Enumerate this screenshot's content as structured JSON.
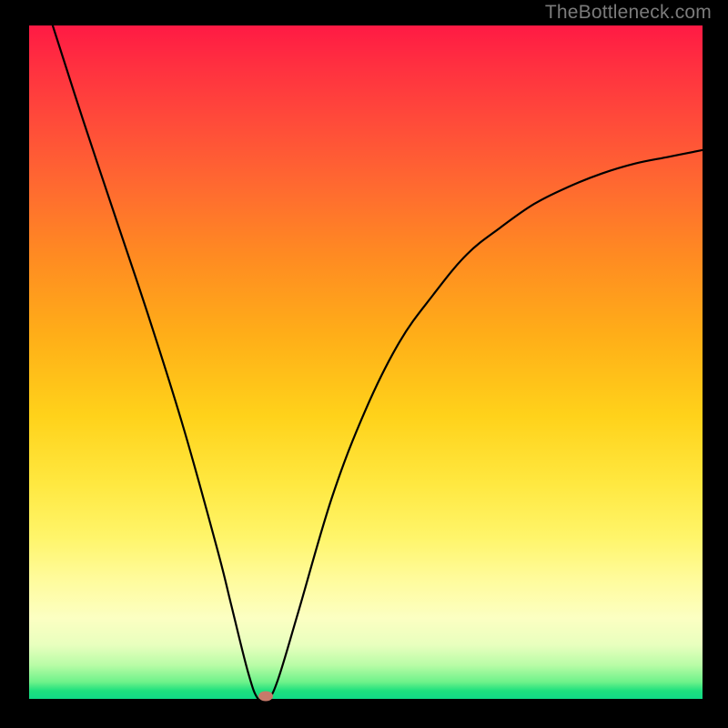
{
  "watermark": "TheBottleneck.com",
  "chart_data": {
    "type": "line",
    "title": "",
    "xlabel": "",
    "ylabel": "",
    "xlim": [
      0,
      1
    ],
    "ylim": [
      0,
      1
    ],
    "grid": false,
    "legend": false,
    "background_gradient": {
      "direction": "vertical",
      "stops": [
        {
          "pos": 0.0,
          "color": "#ff1a44"
        },
        {
          "pos": 0.34,
          "color": "#ff8a22"
        },
        {
          "pos": 0.68,
          "color": "#ffe840"
        },
        {
          "pos": 0.92,
          "color": "#e8ffbe"
        },
        {
          "pos": 1.0,
          "color": "#11da86"
        }
      ]
    },
    "series": [
      {
        "name": "bottleneck-curve",
        "x": [
          0.035,
          0.08,
          0.13,
          0.18,
          0.23,
          0.28,
          0.3,
          0.325,
          0.34,
          0.355,
          0.37,
          0.4,
          0.45,
          0.5,
          0.55,
          0.6,
          0.65,
          0.7,
          0.75,
          0.8,
          0.85,
          0.9,
          0.95,
          1.0
        ],
        "y": [
          1.0,
          0.86,
          0.71,
          0.56,
          0.4,
          0.22,
          0.14,
          0.04,
          0.0,
          0.0,
          0.03,
          0.13,
          0.3,
          0.43,
          0.53,
          0.6,
          0.66,
          0.7,
          0.735,
          0.76,
          0.78,
          0.795,
          0.805,
          0.815
        ],
        "color": "#000000",
        "stroke_width": 2
      }
    ],
    "marker": {
      "name": "optimal-point",
      "x": 0.352,
      "y": 0.0,
      "color": "#c77a6a"
    }
  }
}
